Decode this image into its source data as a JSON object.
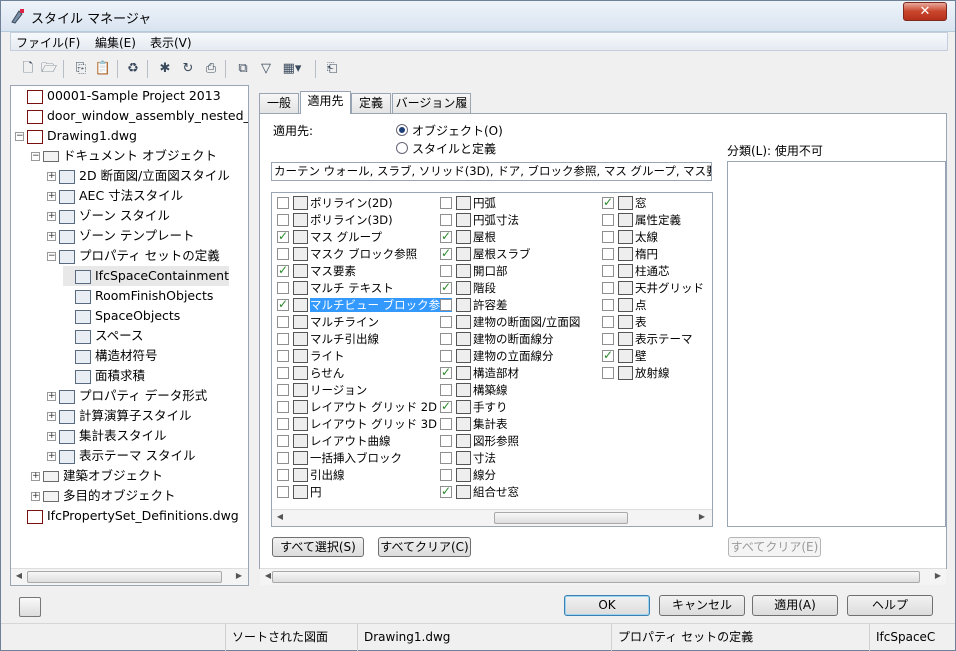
{
  "window": {
    "title": "スタイル マネージャ",
    "close_label": "✕"
  },
  "menu": [
    "ファイル(F)",
    "編集(E)",
    "表示(V)"
  ],
  "toolbar_icons": [
    "new-icon",
    "open-icon",
    "copy-icon",
    "paste-icon",
    "purge-icon",
    "new-style-icon",
    "edit-style-icon",
    "set-from-icon",
    "toggle-view-icon",
    "filter-icon",
    "view-list-icon",
    "help-icon"
  ],
  "tree": [
    {
      "label": "00001-Sample Project 2013",
      "icon": "dwg-icon",
      "exp": ""
    },
    {
      "label": "door_window_assembly_nested_gr",
      "icon": "dwg-icon",
      "exp": ""
    },
    {
      "label": "Drawing1.dwg",
      "icon": "dwg-icon",
      "exp": "−"
    },
    {
      "label": "ドキュメント オブジェクト",
      "icon": "folder-icon",
      "exp": "−"
    },
    {
      "label": "2D 断面図/立面図スタイル",
      "icon": "style-icon",
      "exp": "+"
    },
    {
      "label": "AEC 寸法スタイル",
      "icon": "style-icon",
      "exp": "+"
    },
    {
      "label": "ゾーン スタイル",
      "icon": "style-icon",
      "exp": "+"
    },
    {
      "label": "ゾーン テンプレート",
      "icon": "style-icon",
      "exp": "+"
    },
    {
      "label": "プロパティ セットの定義",
      "icon": "style-icon",
      "exp": "−"
    },
    {
      "label": "IfcSpaceContainment",
      "icon": "style-icon",
      "exp": ""
    },
    {
      "label": "RoomFinishObjects",
      "icon": "style-icon",
      "exp": ""
    },
    {
      "label": "SpaceObjects",
      "icon": "style-icon",
      "exp": ""
    },
    {
      "label": "スペース",
      "icon": "style-icon",
      "exp": ""
    },
    {
      "label": "構造材符号",
      "icon": "style-icon",
      "exp": ""
    },
    {
      "label": "面積求積",
      "icon": "style-icon",
      "exp": ""
    },
    {
      "label": "プロパティ データ形式",
      "icon": "lab-icon",
      "exp": "+"
    },
    {
      "label": "計算演算子スタイル",
      "icon": "style-icon",
      "exp": "+"
    },
    {
      "label": "集計表スタイル",
      "icon": "style-icon",
      "exp": "+"
    },
    {
      "label": "表示テーマ スタイル",
      "icon": "style-icon",
      "exp": "+"
    },
    {
      "label": "建築オブジェクト",
      "icon": "folder-icon",
      "exp": "+"
    },
    {
      "label": "多目的オブジェクト",
      "icon": "folder-icon",
      "exp": "+"
    },
    {
      "label": "IfcPropertySet_Definitions.dwg",
      "icon": "dwg-icon",
      "exp": ""
    }
  ],
  "tabs": [
    "一般",
    "適用先",
    "定義",
    "バージョン履歴"
  ],
  "applies": {
    "label": "適用先:",
    "radio_objects": "オブジェクト(O)",
    "radio_styles": "スタイルと定義",
    "summary": "カーテン ウォール, スラブ, ソリッド(3D), ドア, ブロック参照, マス グループ, マス要素, マルチビュー ...",
    "select_all": "すべて選択(S)",
    "clear_all": "すべてクリア(C)"
  },
  "columns": [
    [
      {
        "label": "ポリライン(2D)",
        "checked": false
      },
      {
        "label": "ポリライン(3D)",
        "checked": false
      },
      {
        "label": "マス グループ",
        "checked": true
      },
      {
        "label": "マスク ブロック参照",
        "checked": false
      },
      {
        "label": "マス要素",
        "checked": true
      },
      {
        "label": "マルチ テキスト",
        "checked": false
      },
      {
        "label": "マルチビュー ブロック参照",
        "checked": true,
        "selected": true
      },
      {
        "label": "マルチライン",
        "checked": false
      },
      {
        "label": "マルチ引出線",
        "checked": false
      },
      {
        "label": "ライト",
        "checked": false
      },
      {
        "label": "らせん",
        "checked": false
      },
      {
        "label": "リージョン",
        "checked": false
      },
      {
        "label": "レイアウト グリッド 2D",
        "checked": false
      },
      {
        "label": "レイアウト グリッド 3D",
        "checked": false
      },
      {
        "label": "レイアウト曲線",
        "checked": false
      },
      {
        "label": "一括挿入ブロック",
        "checked": false
      },
      {
        "label": "引出線",
        "checked": false
      },
      {
        "label": "円",
        "checked": false
      }
    ],
    [
      {
        "label": "円弧",
        "checked": false
      },
      {
        "label": "円弧寸法",
        "checked": false
      },
      {
        "label": "屋根",
        "checked": true
      },
      {
        "label": "屋根スラブ",
        "checked": true
      },
      {
        "label": "開口部",
        "checked": false
      },
      {
        "label": "階段",
        "checked": true
      },
      {
        "label": "許容差",
        "checked": false
      },
      {
        "label": "建物の断面図/立面図",
        "checked": false
      },
      {
        "label": "建物の断面線分",
        "checked": false
      },
      {
        "label": "建物の立面線分",
        "checked": false
      },
      {
        "label": "構造部材",
        "checked": true
      },
      {
        "label": "構築線",
        "checked": false
      },
      {
        "label": "手すり",
        "checked": true
      },
      {
        "label": "集計表",
        "checked": false
      },
      {
        "label": "図形参照",
        "checked": false
      },
      {
        "label": "寸法",
        "checked": false
      },
      {
        "label": "線分",
        "checked": false
      },
      {
        "label": "組合せ窓",
        "checked": true
      }
    ],
    [
      {
        "label": "窓",
        "checked": true
      },
      {
        "label": "属性定義",
        "checked": false
      },
      {
        "label": "太線",
        "checked": false
      },
      {
        "label": "楕円",
        "checked": false
      },
      {
        "label": "柱通芯",
        "checked": false
      },
      {
        "label": "天井グリッド",
        "checked": false
      },
      {
        "label": "点",
        "checked": false
      },
      {
        "label": "表",
        "checked": false
      },
      {
        "label": "表示テーマ",
        "checked": false
      },
      {
        "label": "壁",
        "checked": true
      },
      {
        "label": "放射線",
        "checked": false
      }
    ]
  ],
  "classification": {
    "label": "分類(L): 使用不可",
    "clear_all": "すべてクリア(E)"
  },
  "buttons": {
    "ok": "OK",
    "cancel": "キャンセル",
    "apply": "適用(A)",
    "help": "ヘルプ"
  },
  "status": [
    "ソートされた図面",
    "Drawing1.dwg",
    "プロパティ セットの定義",
    "IfcSpaceC"
  ],
  "colors": {
    "accent": "#3399ff",
    "check": "#2a8a2a"
  }
}
